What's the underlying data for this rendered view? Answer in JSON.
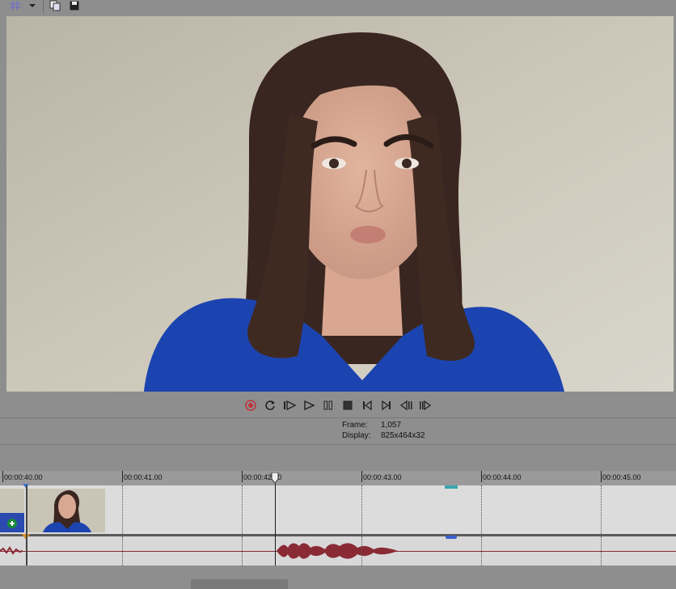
{
  "toolbar": {
    "items": [
      {
        "name": "grid-icon"
      },
      {
        "name": "dropdown-arrow-icon"
      },
      {
        "name": "copy-snapshot-icon"
      },
      {
        "name": "save-snapshot-icon"
      }
    ]
  },
  "transport": {
    "buttons": [
      "record-icon",
      "loop-icon",
      "play-from-start-icon",
      "play-icon",
      "pause-icon",
      "stop-icon",
      "prev-marker-icon",
      "next-marker-icon",
      "prev-frame-icon",
      "next-frame-icon"
    ]
  },
  "info": {
    "frame_label": "Frame:",
    "frame_value": "1,057",
    "display_label": "Display:",
    "display_value": "825x464x32"
  },
  "ruler": {
    "ticks": [
      "00:00:40.00",
      "00:00:41.00",
      "00:00:42.00",
      "00:00:43.00",
      "00:00:44.00",
      "00:00:45.00"
    ]
  },
  "colors": {
    "waveform": "#8a2a35",
    "playhead": "#1a1a1a",
    "marker_orange": "#e09020",
    "marker_blue": "#3a5fd0"
  }
}
